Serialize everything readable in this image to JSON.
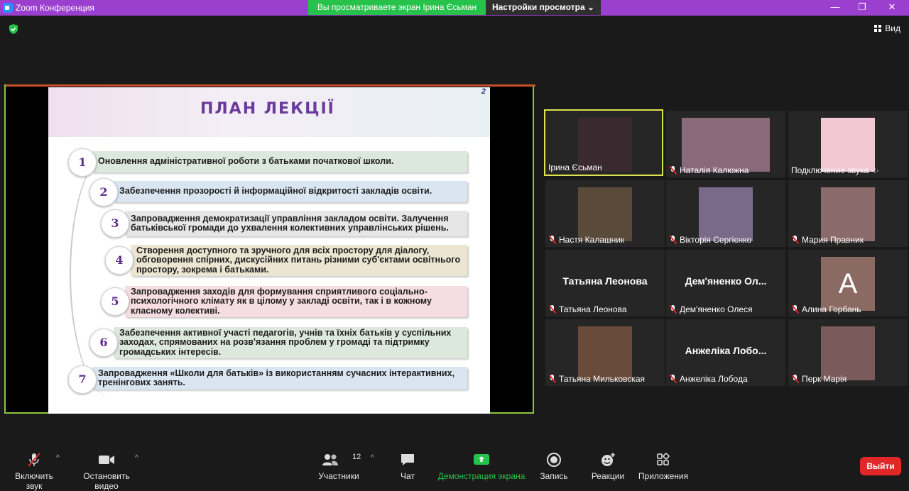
{
  "window": {
    "title": "Zoom Конференция",
    "share_banner": "Вы просматриваете экран Ірина Єсьман",
    "view_settings": "Настройки просмотра",
    "view_button": "Вид",
    "controls": {
      "minimize": "—",
      "maximize": "❐",
      "close": "✕"
    }
  },
  "slide": {
    "page_number": "2",
    "title": "ПЛАН ЛЕКЦІЇ",
    "items": [
      {
        "num": "1",
        "text": "Оновлення адміністративної роботи з батьками початкової школи.",
        "color": "#dde8dc"
      },
      {
        "num": "2",
        "text": "Забезпечення прозорості й інформаційної відкритості закладів освіти.",
        "color": "#d9e6f2"
      },
      {
        "num": "3",
        "text": "Запровадження демократизації управління закладом освіти. Залучення батьківської громади до ухвалення колективних управлінських рішень.",
        "color": "#e6e6e6"
      },
      {
        "num": "4",
        "text": "Створення доступного та зручного для всіх простору для діалогу, обговорення спірних, дискусійних питань різними суб'єктами освітнього простору, зокрема і батьками.",
        "color": "#ece5d2"
      },
      {
        "num": "5",
        "text": "Запровадження заходів для формування сприятливого соціально-психологічного клімату як в цілому у закладі освіти, так і в кожному класному колективі.",
        "color": "#f5dde1"
      },
      {
        "num": "6",
        "text": "Забезпечення активної участі педагогів, учнів та їхніх батьків у суспільних заходах, спрямованих на розв'язання проблем у громаді та підтримку громадських інтересів.",
        "color": "#dde8dc"
      },
      {
        "num": "7",
        "text": "Запровадження «Школи для батьків» із використанням сучасних інтерактивних, тренінгових занять.",
        "color": "#d9e6f2"
      }
    ]
  },
  "participants": [
    {
      "name": "Ірина Єсьман",
      "muted": false,
      "active": true,
      "avatar": "photo",
      "color": "#3a2a30"
    },
    {
      "name": "Наталія Калюжна",
      "muted": true,
      "avatar": "photo",
      "color": "#8a6a7a"
    },
    {
      "name": "Подключение звука ·:·",
      "muted": false,
      "avatar": "drawing",
      "color": "#f2c7d4"
    },
    {
      "name": "Настя Калашник",
      "muted": true,
      "avatar": "photo",
      "color": "#5a4a3a"
    },
    {
      "name": "Вікторія Сергієнко",
      "muted": true,
      "avatar": "photo",
      "color": "#7a6a8a"
    },
    {
      "name": "Мария Правник",
      "muted": true,
      "avatar": "photo",
      "color": "#8a6a6a"
    },
    {
      "name": "Татьяна Леонова",
      "display": "Татьяна Леонова",
      "muted": true,
      "avatar": "none"
    },
    {
      "name": "Дем'яненко Олеся",
      "display": "Дем'яненко Ол...",
      "muted": true,
      "avatar": "none"
    },
    {
      "name": "Алина Горбань",
      "muted": true,
      "avatar": "letter",
      "letter": "A",
      "color": "#8a6a62"
    },
    {
      "name": "Татьяна Мильковская",
      "muted": true,
      "avatar": "photo",
      "color": "#6a4a3a"
    },
    {
      "name": "Анжеліка Лобода",
      "display": "Анжеліка Лобо...",
      "muted": true,
      "avatar": "none"
    },
    {
      "name": "Перк Марія",
      "muted": true,
      "avatar": "photo",
      "color": "#7a5a5a"
    }
  ],
  "toolbar": {
    "audio_label": "Включить звук",
    "video_label": "Остановить видео",
    "participants_label": "Участники",
    "participants_count": "12",
    "chat_label": "Чат",
    "share_label": "Демонстрация экрана",
    "record_label": "Запись",
    "reactions_label": "Реакции",
    "apps_label": "Приложения",
    "leave_label": "Выйти"
  },
  "colors": {
    "title_bar": "#9b3fcf",
    "share_banner": "#27c24c",
    "active_border": "#dde34b",
    "share_border": "#8dc53e",
    "leave": "#e02828",
    "share_icon": "#27c24c"
  }
}
